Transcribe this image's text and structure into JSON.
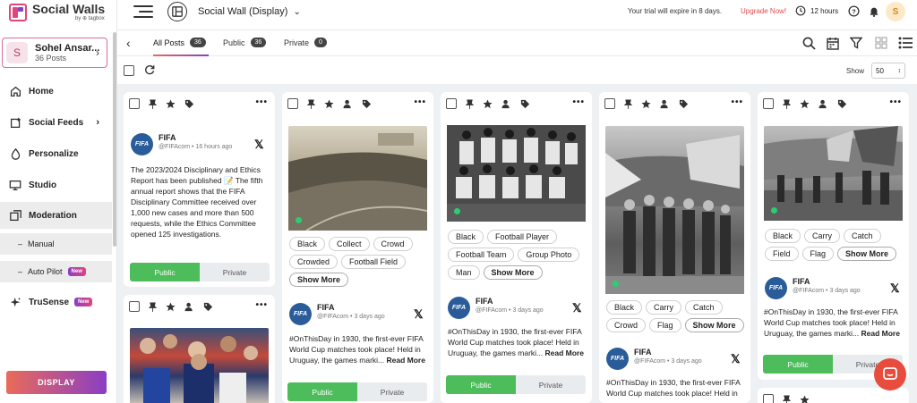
{
  "brand": {
    "title": "Social Walls",
    "sub": "by ⊕ tagbox"
  },
  "account": {
    "initial": "S",
    "name": "Sohel Ansar...",
    "posts": "36 Posts"
  },
  "nav": {
    "home": "Home",
    "social_feeds": "Social Feeds",
    "personalize": "Personalize",
    "studio": "Studio",
    "moderation": "Moderation",
    "manual": "Manual",
    "auto_pilot": "Auto Pilot",
    "trusense": "TruSense",
    "new_badge": "New",
    "display": "DISPLAY"
  },
  "header": {
    "wall_title": "Social Wall (Display)",
    "trial": "Your trial will expire in 8 days.",
    "upgrade": "Upgrade Now!",
    "time_format": "12 hours",
    "user_initial": "S"
  },
  "tabs": [
    {
      "label": "All Posts",
      "count": "36"
    },
    {
      "label": "Public",
      "count": "36"
    },
    {
      "label": "Private",
      "count": "0"
    }
  ],
  "toolbar": {
    "show_label": "Show",
    "show_value": "50"
  },
  "labels": {
    "public": "Public",
    "private": "Private",
    "show_more": "Show More",
    "read_more": "Read More"
  },
  "posts": {
    "p1": {
      "author": "FIFA",
      "handle": "@FIFAcom • 16 hours ago",
      "text": "The 2023/2024 Disciplinary and Ethics Report has been published 📝 The fifth annual report shows that the FIFA Disciplinary Committee received over 1,000 new cases and more than 500 requests, while the Ethics Committee opened 125 investigations."
    },
    "p2": {
      "tags": [
        "Black",
        "Collect",
        "Crowd",
        "Crowded",
        "Football Field"
      ],
      "author": "FIFA",
      "handle": "@FIFAcom • 3 days ago",
      "text": "#OnThisDay in 1930, the first-ever FIFA World Cup matches took place! Held in Uruguay, the games marki..."
    },
    "p3": {
      "tags": [
        "Black",
        "Football Player",
        "Football Team",
        "Group Photo",
        "Man"
      ],
      "author": "FIFA",
      "handle": "@FIFAcom • 3 days ago",
      "text": "#OnThisDay in 1930, the first-ever FIFA World Cup matches took place! Held in Uruguay, the games marki..."
    },
    "p4": {
      "tags": [
        "Black",
        "Carry",
        "Catch",
        "Crowd",
        "Flag"
      ],
      "author": "FIFA",
      "handle": "@FIFAcom • 3 days ago",
      "text": "#OnThisDay in 1930, the first-ever FIFA World Cup matches took place! Held in"
    },
    "p5": {
      "tags": [
        "Black",
        "Carry",
        "Catch",
        "Field",
        "Flag"
      ],
      "author": "FIFA",
      "handle": "@FIFAcom • 3 days ago",
      "text": "#OnThisDay in 1930, the first-ever FIFA World Cup matches took place! Held in Uruguay, the games marki..."
    }
  },
  "colors": {
    "public_green": "#4dbd5b",
    "accent_pink": "#e2457a",
    "accent_purple": "#8a3ec4",
    "upgrade_red": "#e04c4c"
  }
}
